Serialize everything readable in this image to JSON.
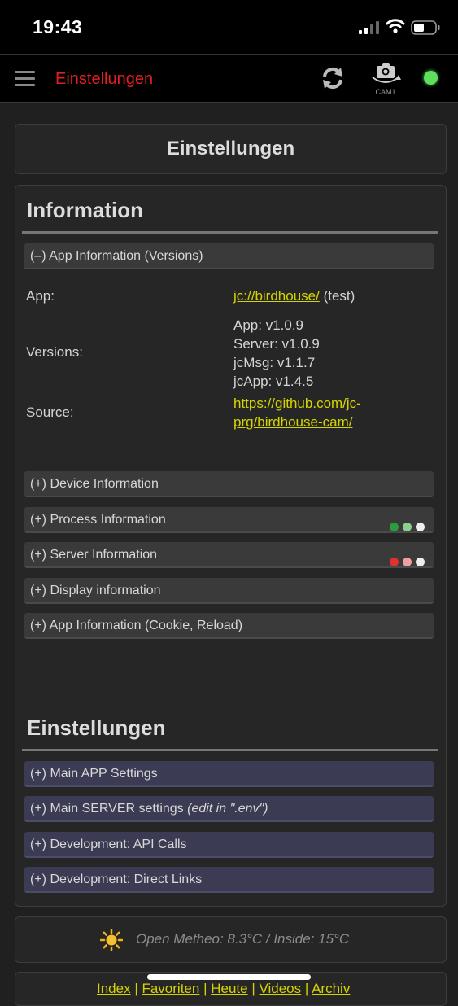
{
  "status_bar": {
    "time": "19:43"
  },
  "top_bar": {
    "title": "Einstellungen",
    "camera_label": "CAM1",
    "colors": {
      "title": "#e02020",
      "status_dot": "#5ee05e"
    }
  },
  "page_title": "Einstellungen",
  "information": {
    "heading": "Information",
    "app_info_bar": "(–) App Information (Versions)",
    "rows": {
      "app_label": "App:",
      "app_link": "jc://birdhouse/",
      "app_suffix": " (test)",
      "versions_label": "Versions:",
      "versions": [
        "App: v1.0.9",
        "Server: v1.0.9",
        "jcMsg: v1.1.7",
        "jcApp: v1.4.5"
      ],
      "source_label": "Source:",
      "source_link_line1": "https://github.com/jc-",
      "source_link_line2": "prg/birdhouse-cam/"
    },
    "bars": [
      {
        "label": "(+) Device Information"
      },
      {
        "label": "(+) Process Information",
        "dots": [
          "#2e9a3e",
          "#8fcf8f",
          "#eeeeee"
        ]
      },
      {
        "label": "(+) Server Information",
        "dots": [
          "#e03030",
          "#f0a0a0",
          "#eeeeee"
        ]
      },
      {
        "label": "(+) Display information"
      },
      {
        "label": "(+) App Information (Cookie, Reload)"
      }
    ]
  },
  "settings": {
    "heading": "Einstellungen",
    "bars": [
      {
        "label": "(+) Main APP Settings"
      },
      {
        "label": "(+) Main SERVER settings ",
        "note": "(edit in \".env\")"
      },
      {
        "label": "(+) Development: API Calls"
      },
      {
        "label": "(+) Development: Direct Links"
      }
    ]
  },
  "weather": {
    "text": "Open Metheo: 8.3°C / Inside: 15°C",
    "icon": "sun-icon"
  },
  "footer": {
    "links": [
      "Index",
      "Favoriten",
      "Heute",
      "Videos",
      "Archiv"
    ]
  }
}
